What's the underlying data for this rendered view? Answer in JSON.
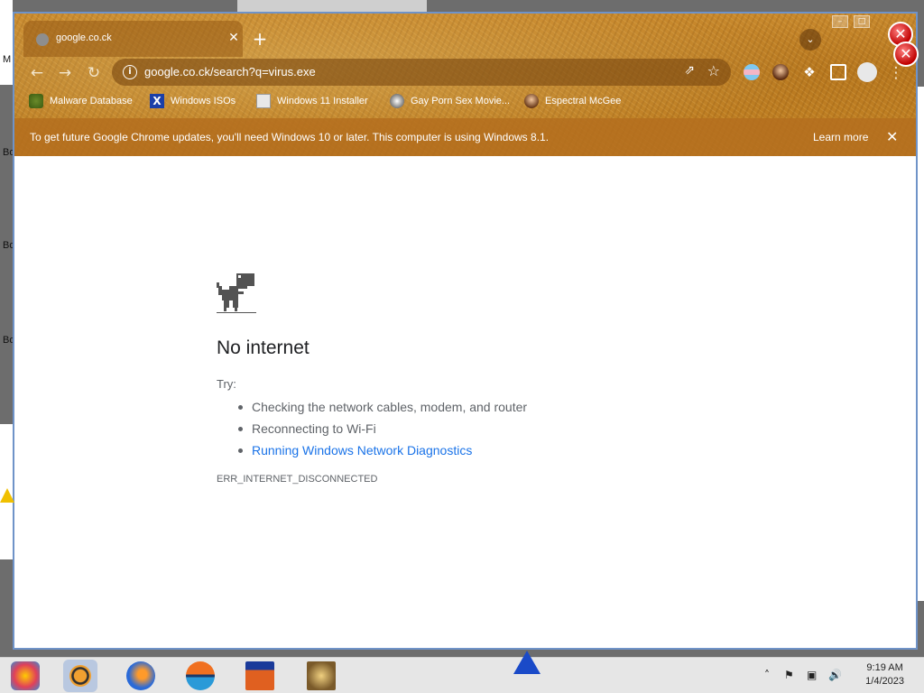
{
  "desktop": {
    "edge_letters": [
      "M",
      "Bo",
      "Bo",
      "Bo"
    ]
  },
  "tab": {
    "title": "google.co.ck",
    "close_symbol": "✕",
    "new_tab_symbol": "+"
  },
  "toolbar": {
    "back_symbol": "←",
    "forward_symbol": "→",
    "reload_symbol": "↻",
    "url": "google.co.ck/search?q=virus.exe",
    "menu_symbol": "⋮"
  },
  "bookmarks": [
    {
      "label": "Malware Database",
      "icon": "leaf-icon"
    },
    {
      "label": "Windows ISOs",
      "icon": "x-logo-icon"
    },
    {
      "label": "Windows 11 Installer",
      "icon": "installer-icon"
    },
    {
      "label": "Gay Porn Sex Movie...",
      "icon": "globe-icon"
    },
    {
      "label": "Espectral McGee",
      "icon": "avatar-icon"
    }
  ],
  "infobar": {
    "message": "To get future Google Chrome updates, you'll need Windows 10 or later. This computer is using Windows 8.1.",
    "learn_more": "Learn more",
    "close_symbol": "✕"
  },
  "error_page": {
    "heading": "No internet",
    "try_label": "Try:",
    "suggestions": [
      "Checking the network cables, modem, and router",
      "Reconnecting to Wi-Fi",
      "Running Windows Network Diagnostics"
    ],
    "error_code": "ERR_INTERNET_DISCONNECTED"
  },
  "taskbar": {
    "apps": [
      "photos-app-icon",
      "chrome-app-icon",
      "firefox-app-icon",
      "sunset-app-icon",
      "files-app-icon",
      "game-app-icon"
    ],
    "warning_icon": "warning-icon",
    "time": "9:19 AM",
    "date": "1/4/2023"
  },
  "colors": {
    "accent_link": "#1a73e8",
    "theme_brown": "#b8781f",
    "window_border": "#6f93c8"
  }
}
